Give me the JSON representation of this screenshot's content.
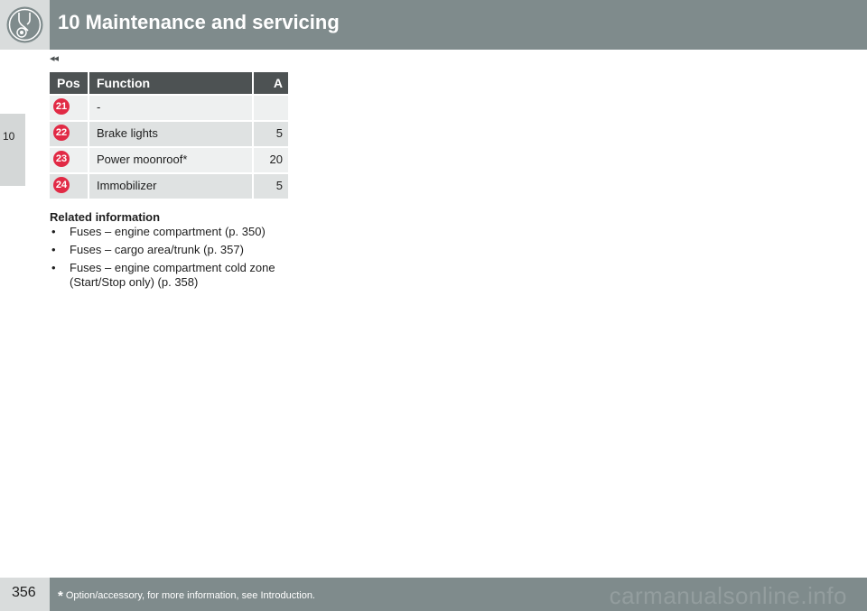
{
  "header": {
    "title": "10 Maintenance and servicing",
    "icon": "wrench-gear-icon"
  },
  "side_tab": {
    "label": "10"
  },
  "continuation_marker": "◂◂",
  "table": {
    "headers": {
      "pos": "Pos",
      "function": "Function",
      "a": "A"
    },
    "rows": [
      {
        "pos": "21",
        "function": "-",
        "a": ""
      },
      {
        "pos": "22",
        "function": "Brake lights",
        "a": "5"
      },
      {
        "pos": "23",
        "function": "Power moonroof*",
        "a": "20"
      },
      {
        "pos": "24",
        "function": "Immobilizer",
        "a": "5"
      }
    ],
    "badge_color": "#e12a45"
  },
  "related": {
    "title": "Related information",
    "items": [
      "Fuses – engine compartment (p. 350)",
      "Fuses – cargo area/trunk (p. 357)",
      "Fuses – engine compartment cold zone (Start/Stop only) (p. 358)"
    ]
  },
  "footer": {
    "page_number": "356",
    "footnote_star": "*",
    "footnote": "Option/accessory, for more information, see Introduction.",
    "watermark": "carmanualsonline.info"
  },
  "colors": {
    "header_bar": "#7f8b8c",
    "table_header": "#4d5253",
    "accent_red": "#e12a45"
  }
}
